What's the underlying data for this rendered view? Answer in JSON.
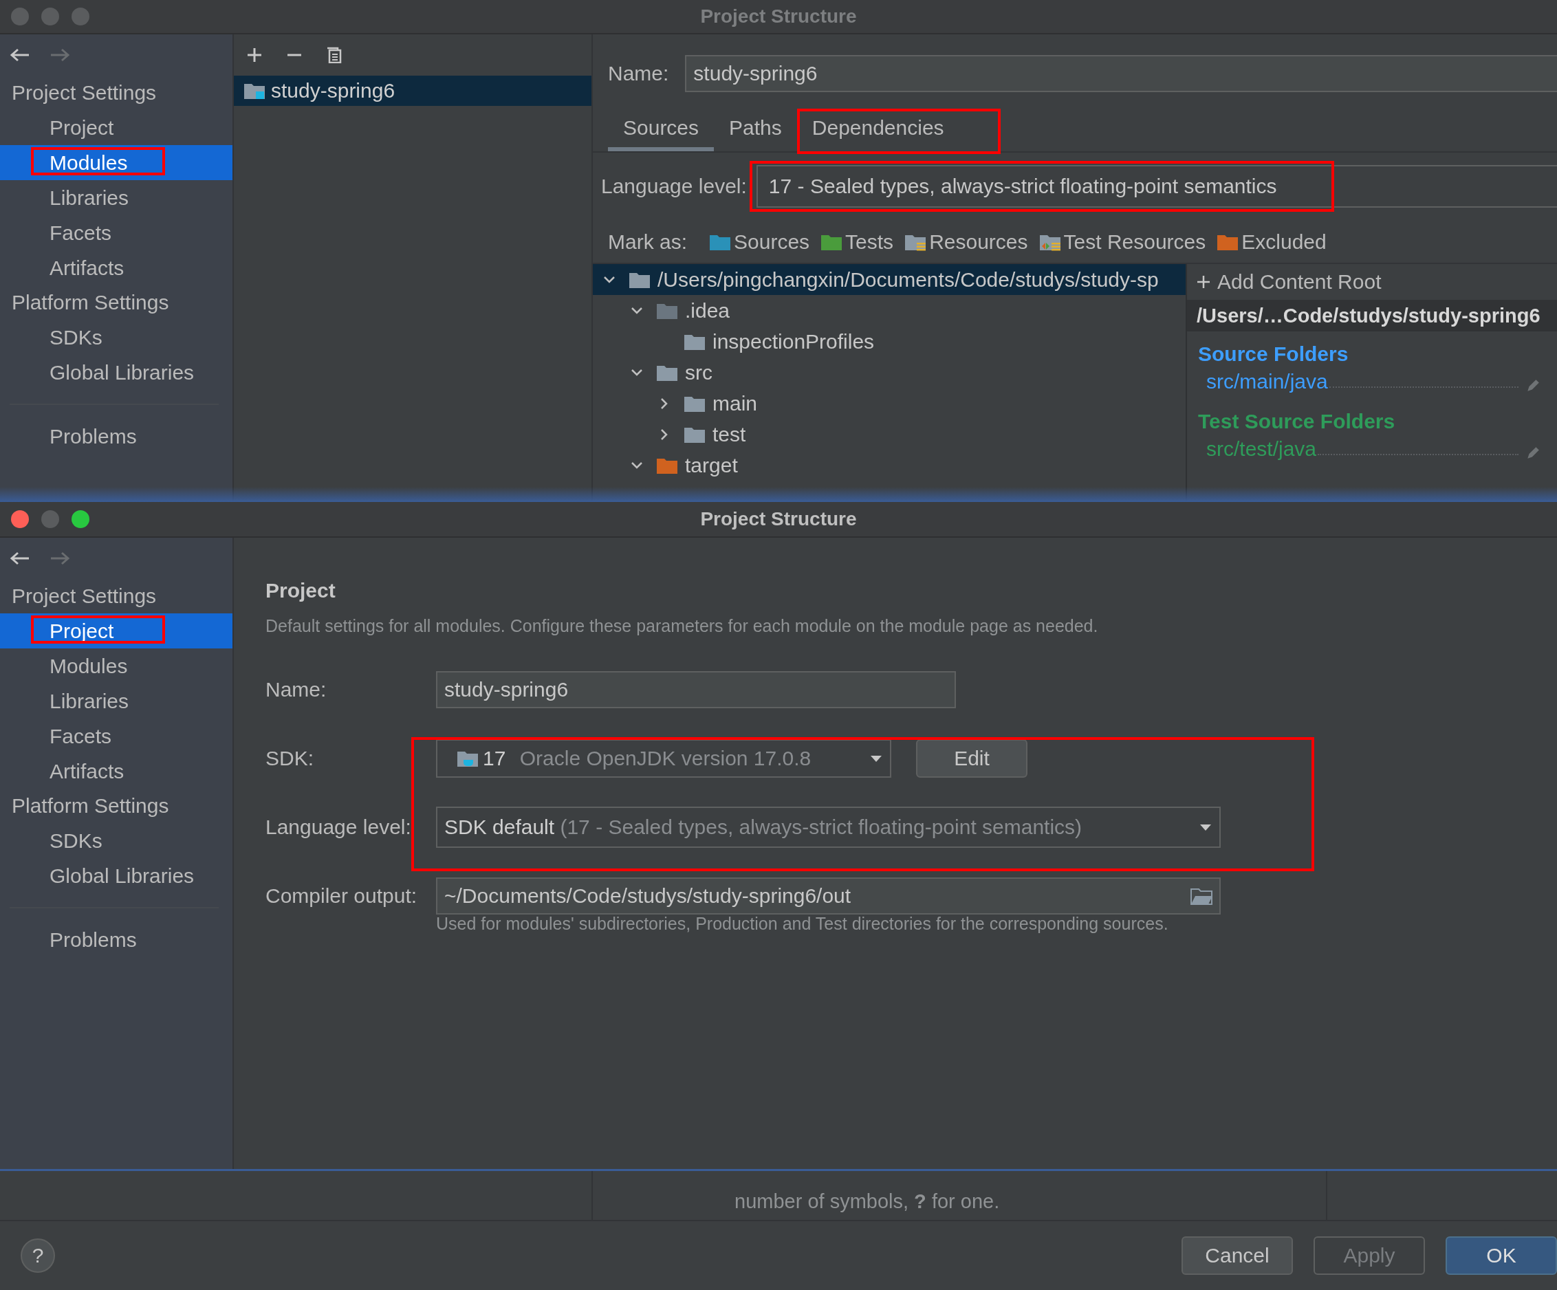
{
  "back_window": {
    "title": "Project Structure",
    "active": false,
    "sidebar": {
      "sections": [
        {
          "title": "Project Settings",
          "items": [
            {
              "label": "Project",
              "selected": false,
              "highlighted": false
            },
            {
              "label": "Modules",
              "selected": true,
              "highlighted": true
            },
            {
              "label": "Libraries",
              "selected": false,
              "highlighted": false
            },
            {
              "label": "Facets",
              "selected": false,
              "highlighted": false
            },
            {
              "label": "Artifacts",
              "selected": false,
              "highlighted": false
            }
          ]
        },
        {
          "title": "Platform Settings",
          "items": [
            {
              "label": "SDKs",
              "selected": false,
              "highlighted": false
            },
            {
              "label": "Global Libraries",
              "selected": false,
              "highlighted": false
            }
          ]
        }
      ],
      "footer_items": [
        {
          "label": "Problems",
          "selected": false,
          "highlighted": false
        }
      ]
    },
    "modules": [
      {
        "name": "study-spring6",
        "selected": true
      }
    ],
    "name_label": "Name:",
    "name_value": "study-spring6",
    "tabs": [
      {
        "label": "Sources",
        "selected": true,
        "highlighted": false
      },
      {
        "label": "Paths",
        "selected": false,
        "highlighted": false
      },
      {
        "label": "Dependencies",
        "selected": false,
        "highlighted": true
      }
    ],
    "language_level": {
      "label": "Language level:",
      "value": "17 - Sealed types, always-strict floating-point semantics",
      "highlighted": true
    },
    "mark_as": {
      "label": "Mark as:",
      "options": [
        {
          "label": "Sources",
          "kind": "sources"
        },
        {
          "label": "Tests",
          "kind": "tests"
        },
        {
          "label": "Resources",
          "kind": "resources"
        },
        {
          "label": "Test Resources",
          "kind": "test_resources"
        },
        {
          "label": "Excluded",
          "kind": "excluded"
        }
      ]
    },
    "tree": [
      {
        "label": "/Users/pingchangxin/Documents/Code/studys/study-sp",
        "kind": "folder",
        "selected": true,
        "expanded": true,
        "children": [
          {
            "label": ".idea",
            "kind": "hidden",
            "selected": false,
            "expanded": true,
            "children": [
              {
                "label": "inspectionProfiles",
                "kind": "folder",
                "selected": false
              }
            ]
          },
          {
            "label": "src",
            "kind": "folder",
            "selected": false,
            "expanded": true,
            "children": [
              {
                "label": "main",
                "kind": "folder",
                "selected": false,
                "expanded": false
              },
              {
                "label": "test",
                "kind": "folder",
                "selected": false,
                "expanded": false
              }
            ]
          },
          {
            "label": "target",
            "kind": "excluded",
            "selected": false,
            "expanded": true
          }
        ]
      }
    ],
    "content_root": {
      "add_label": "Add Content Root",
      "path": "/Users/…Code/studys/study-spring6",
      "groups": [
        {
          "title": "Source Folders",
          "kind": "source",
          "folders": [
            "src/main/java"
          ]
        },
        {
          "title": "Test Source Folders",
          "kind": "test",
          "folders": [
            "src/test/java"
          ]
        }
      ]
    },
    "hint": "number of symbols, **?** for one."
  },
  "front_window": {
    "title": "Project Structure",
    "active": true,
    "sidebar": {
      "sections": [
        {
          "title": "Project Settings",
          "items": [
            {
              "label": "Project",
              "selected": true,
              "highlighted": true
            },
            {
              "label": "Modules",
              "selected": false,
              "highlighted": false
            },
            {
              "label": "Libraries",
              "selected": false,
              "highlighted": false
            },
            {
              "label": "Facets",
              "selected": false,
              "highlighted": false
            },
            {
              "label": "Artifacts",
              "selected": false,
              "highlighted": false
            }
          ]
        },
        {
          "title": "Platform Settings",
          "items": [
            {
              "label": "SDKs",
              "selected": false,
              "highlighted": false
            },
            {
              "label": "Global Libraries",
              "selected": false,
              "highlighted": false
            }
          ]
        }
      ],
      "footer_items": [
        {
          "label": "Problems",
          "selected": false,
          "highlighted": false
        }
      ]
    },
    "heading": "Project",
    "description": "Default settings for all modules. Configure these parameters for each module on the module page as needed.",
    "name": {
      "label": "Name:",
      "value": "study-spring6"
    },
    "sdk": {
      "label": "SDK:",
      "version": "17",
      "name": "Oracle OpenJDK version 17.0.8",
      "edit_label": "Edit"
    },
    "language_level": {
      "label": "Language level:",
      "default_label": "SDK default",
      "detail": "(17 - Sealed types, always-strict floating-point semantics)"
    },
    "sdk_group_highlighted": true,
    "compiler_output": {
      "label": "Compiler output:",
      "value": "~/Documents/Code/studys/study-spring6/out",
      "hint": "Used for modules' subdirectories, Production and Test directories for the corresponding sources."
    }
  },
  "help_label": "?",
  "buttons": [
    {
      "label": "Cancel",
      "kind": "default"
    },
    {
      "label": "Apply",
      "kind": "disabled"
    },
    {
      "label": "OK",
      "kind": "primary"
    }
  ]
}
